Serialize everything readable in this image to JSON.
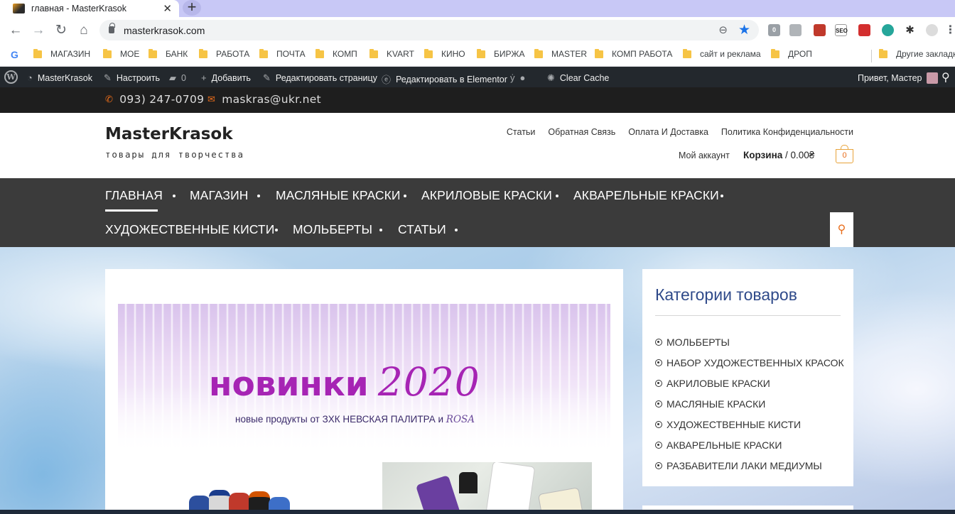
{
  "browser": {
    "tab_title": "главная - MasterKrasok",
    "tab_close": "✕",
    "new_tab": "+",
    "url": "masterkrasok.com",
    "bookmarks": [
      "МАГАЗИН",
      "МОЕ",
      "БАНК",
      "РАБОТА",
      "ПОЧТА",
      "КОМП",
      "KVART",
      "КИНО",
      "БИРЖА",
      "MASTER",
      "КОМП РАБОТА",
      "сайт и реклама",
      "ДРОП"
    ],
    "other_bookmarks": "Другие закладк",
    "extensions": [
      "0",
      "SEO"
    ]
  },
  "adminbar": {
    "site": "MasterKrasok",
    "customize": "Настроить",
    "comments_count": "0",
    "add_new": "Добавить",
    "edit_page": "Редактировать страницу",
    "edit_elementor": "Редактировать в Elementor",
    "clear_cache": "Clear Cache",
    "greeting": "Привет, Мастер"
  },
  "topbar": {
    "phone": "093) 247-0709",
    "email": "maskras@ukr.net"
  },
  "header": {
    "site_title": "MasterKrasok",
    "tagline": "товары для творчества",
    "links": [
      "Статьи",
      "Обратная Связь",
      "Оплата И Доставка",
      "Политика Конфиденциальности"
    ],
    "my_account": "Мой аккаунт",
    "cart_label": "Корзина",
    "cart_sep": "/",
    "cart_total": "0.00₴",
    "cart_count": "0"
  },
  "nav": {
    "row1": [
      "ГЛАВНАЯ",
      "МАГАЗИН",
      "МАСЛЯНЫЕ КРАСКИ",
      "АКРИЛОВЫЕ КРАСКИ",
      "АКВАРЕЛЬНЫЕ КРАСКИ"
    ],
    "row2": [
      "ХУДОЖЕСТВЕННЫЕ КИСТИ",
      "МОЛЬБЕРТЫ",
      "СТАТЬИ"
    ]
  },
  "banner": {
    "title_word": "новинки",
    "title_year": "2020",
    "subtitle": "новые продукты от ЗХК НЕВСКАЯ ПАЛИТРА и",
    "subtitle_brand": "ROSA"
  },
  "sidebar": {
    "title": "Категории товаров",
    "categories": [
      "МОЛЬБЕРТЫ",
      "НАБОР ХУДОЖЕСТВЕННЫХ КРАСОК",
      "АКРИЛОВЫЕ КРАСКИ",
      "МАСЛЯНЫЕ КРАСКИ",
      "ХУДОЖЕСТВЕННЫЕ КИСТИ",
      "АКВАРЕЛЬНЫЕ КРАСКИ",
      "РАЗБАВИТЕЛИ ЛАКИ МЕДИУМЫ"
    ]
  },
  "colors": {
    "accent_orange": "#e86c1a",
    "banner_purple": "#a624b4",
    "widget_blue": "#2f4a8a",
    "nav_bg": "#3b3b3b",
    "topbar_bg": "#1e1e1e"
  }
}
